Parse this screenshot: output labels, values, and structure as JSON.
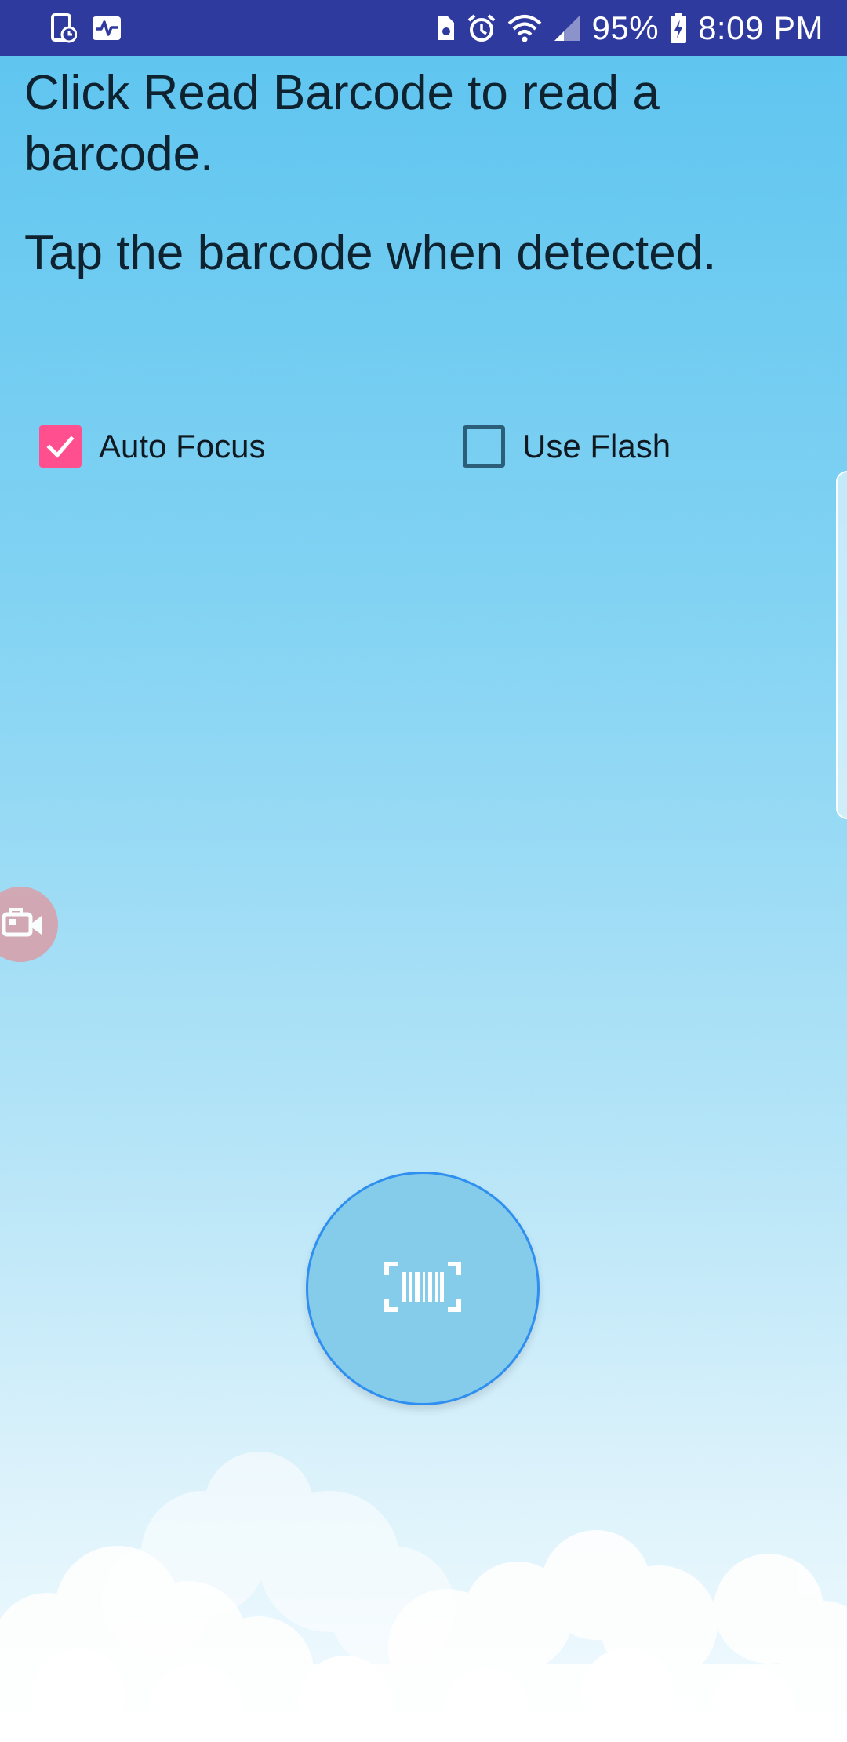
{
  "status_bar": {
    "battery": "95%",
    "time": "8:09 PM",
    "icons": [
      "screenshot-icon",
      "activity-icon",
      "sim-icon",
      "alarm-icon",
      "wifi-icon",
      "signal-icon",
      "battery-charging-icon"
    ]
  },
  "instructions": {
    "line1": "Click Read Barcode to read a barcode.",
    "line2": "Tap the barcode when detected."
  },
  "options": {
    "auto_focus": {
      "label": "Auto Focus",
      "checked": true
    },
    "use_flash": {
      "label": "Use Flash",
      "checked": false
    }
  },
  "read_barcode_button": {
    "icon": "barcode-scan-icon"
  },
  "floating_recorder": {
    "icon": "video-camera-icon"
  },
  "colors": {
    "status_bar": "#2f3a9f",
    "checkbox_checked": "#ff4f8e",
    "button_fill": "#85cceb",
    "button_border": "#2f8ff0"
  }
}
